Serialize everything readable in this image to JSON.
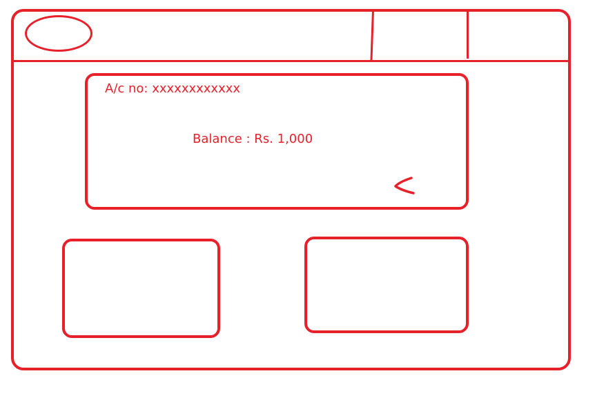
{
  "account": {
    "number_label": "A/c no: xxxxxxxxxxxx",
    "balance_label": "Balance : Rs. 1,000"
  },
  "icons": {
    "logo": "logo-oval-placeholder",
    "back": "chevron-left-icon"
  },
  "colors": {
    "accent": "#e8202a",
    "background": "#ffffff"
  }
}
